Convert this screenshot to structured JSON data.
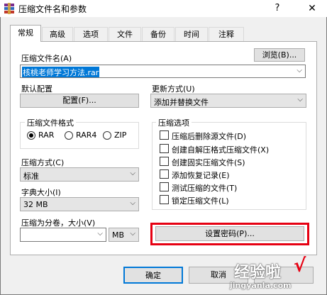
{
  "window": {
    "title": "压缩文件名和参数",
    "help": "?",
    "close": "✕"
  },
  "tabs": [
    "常规",
    "高级",
    "选项",
    "文件",
    "备份",
    "时间",
    "注释"
  ],
  "archive": {
    "label": "压缩文件名(A)",
    "value": "核桃老师学习方法.rar",
    "browse": "浏览(B)..."
  },
  "profile": {
    "label": "默认配置",
    "button": "配置(F)..."
  },
  "update": {
    "label": "更新方式(U)",
    "value": "添加并替换文件"
  },
  "format": {
    "label": "压缩文件格式",
    "options": [
      "RAR",
      "RAR4",
      "ZIP"
    ],
    "selected": "RAR"
  },
  "method": {
    "label": "压缩方式(C)",
    "value": "标准"
  },
  "dictionary": {
    "label": "字典大小(I)",
    "value": "32 MB"
  },
  "split": {
    "label": "压缩为分卷，大小(V)",
    "value": "",
    "unit": "MB"
  },
  "compress_options": {
    "label": "压缩选项",
    "items": [
      {
        "label": "压缩后删除源文件(D)",
        "checked": false
      },
      {
        "label": "创建自解压格式压缩文件(X)",
        "checked": false
      },
      {
        "label": "创建固实压缩文件(S)",
        "checked": false
      },
      {
        "label": "添加恢复记录(E)",
        "checked": false
      },
      {
        "label": "测试压缩的文件(T)",
        "checked": false
      },
      {
        "label": "锁定压缩文件(L)",
        "checked": false
      }
    ]
  },
  "password_button": "设置密码(P)...",
  "footer": {
    "ok": "确定",
    "cancel": "取消"
  },
  "watermark": {
    "line1": "经验啦",
    "check": "√",
    "line2": "jingyanla.com"
  },
  "colors": {
    "highlight_frame": "#e60012",
    "selection": "#0078d7"
  }
}
